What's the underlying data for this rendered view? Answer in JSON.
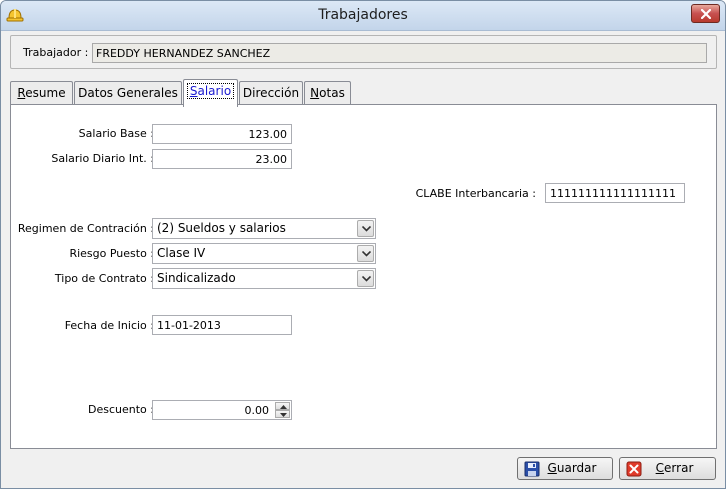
{
  "window": {
    "title": "Trabajadores"
  },
  "worker": {
    "label": "Trabajador :",
    "value": "FREDDY HERNANDEZ SANCHEZ"
  },
  "tabs": [
    {
      "label": "Resume",
      "key_index": 0,
      "active": false
    },
    {
      "label": "Datos Generales",
      "key_index": -1,
      "active": false
    },
    {
      "label": "Salario",
      "key_index": 0,
      "active": true
    },
    {
      "label": "Dirección",
      "key_index": -1,
      "active": false
    },
    {
      "label": "Notas",
      "key_index": 0,
      "active": false
    }
  ],
  "salario": {
    "base_label": "Salario Base :",
    "base_value": "123.00",
    "diario_label": "Salario Diario Int. :",
    "diario_value": "23.00",
    "clabe_label": "CLABE Interbancaria :",
    "clabe_value": "111111111111111111",
    "regimen_label": "Regimen de Contración :",
    "regimen_value": "(2) Sueldos y salarios",
    "riesgo_label": "Riesgo Puesto :",
    "riesgo_value": "Clase IV",
    "contrato_label": "Tipo de Contrato :",
    "contrato_value": "Sindicalizado",
    "fecha_label": "Fecha de Inicio :",
    "fecha_value": "11-01-2013",
    "descuento_label": "Descuento :",
    "descuento_value": "0.00"
  },
  "buttons": {
    "guardar": {
      "label": "Guardar",
      "key_index": 0
    },
    "cerrar": {
      "label": "Cerrar",
      "key_index": 0
    }
  },
  "colors": {
    "active_tab_text": "#1a1ad0",
    "close_button": "#c75050"
  }
}
